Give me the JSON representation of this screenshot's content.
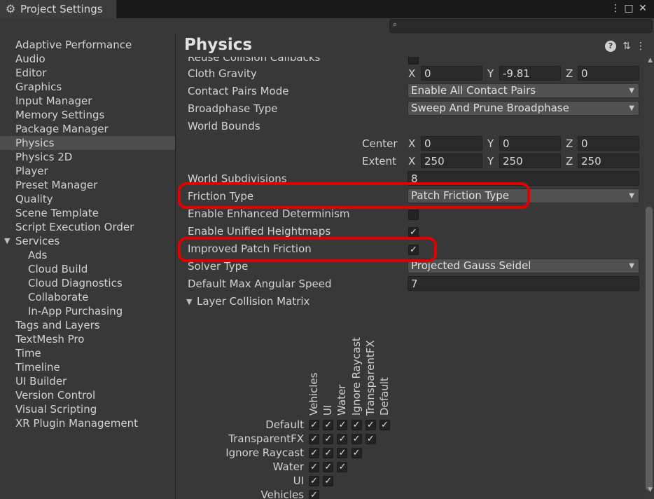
{
  "window": {
    "tab_title": "Project Settings",
    "buttons": {
      "menu": "⋮",
      "maximize": "□",
      "close": "✕"
    }
  },
  "search": {
    "placeholder": "",
    "value": ""
  },
  "sidebar": {
    "items": [
      {
        "label": "Adaptive Performance",
        "indent": 0
      },
      {
        "label": "Audio",
        "indent": 0
      },
      {
        "label": "Editor",
        "indent": 0
      },
      {
        "label": "Graphics",
        "indent": 0
      },
      {
        "label": "Input Manager",
        "indent": 0
      },
      {
        "label": "Memory Settings",
        "indent": 0
      },
      {
        "label": "Package Manager",
        "indent": 0
      },
      {
        "label": "Physics",
        "indent": 0,
        "selected": true
      },
      {
        "label": "Physics 2D",
        "indent": 0
      },
      {
        "label": "Player",
        "indent": 0
      },
      {
        "label": "Preset Manager",
        "indent": 0
      },
      {
        "label": "Quality",
        "indent": 0
      },
      {
        "label": "Scene Template",
        "indent": 0
      },
      {
        "label": "Script Execution Order",
        "indent": 0
      },
      {
        "label": "Services",
        "indent": 0,
        "expanded": true
      },
      {
        "label": "Ads",
        "indent": 1
      },
      {
        "label": "Cloud Build",
        "indent": 1
      },
      {
        "label": "Cloud Diagnostics",
        "indent": 1
      },
      {
        "label": "Collaborate",
        "indent": 1
      },
      {
        "label": "In-App Purchasing",
        "indent": 1
      },
      {
        "label": "Tags and Layers",
        "indent": 0
      },
      {
        "label": "TextMesh Pro",
        "indent": 0
      },
      {
        "label": "Time",
        "indent": 0
      },
      {
        "label": "Timeline",
        "indent": 0
      },
      {
        "label": "UI Builder",
        "indent": 0
      },
      {
        "label": "Version Control",
        "indent": 0
      },
      {
        "label": "Visual Scripting",
        "indent": 0
      },
      {
        "label": "XR Plugin Management",
        "indent": 0
      }
    ]
  },
  "physics": {
    "title": "Physics",
    "reuse_collision_callbacks": "Reuse Collision Callbacks",
    "cloth_gravity": {
      "label": "Cloth Gravity",
      "x": "0",
      "y": "-9.81",
      "z": "0"
    },
    "contact_pairs_mode": {
      "label": "Contact Pairs Mode",
      "value": "Enable All Contact Pairs"
    },
    "broadphase_type": {
      "label": "Broadphase Type",
      "value": "Sweep And Prune Broadphase"
    },
    "world_bounds": {
      "label": "World Bounds",
      "center": {
        "label": "Center",
        "x": "0",
        "y": "0",
        "z": "0"
      },
      "extent": {
        "label": "Extent",
        "x": "250",
        "y": "250",
        "z": "250"
      }
    },
    "world_subdivisions": {
      "label": "World Subdivisions",
      "value": "8"
    },
    "friction_type": {
      "label": "Friction Type",
      "value": "Patch Friction Type"
    },
    "enhanced_determinism": {
      "label": "Enable Enhanced Determinism",
      "checked": false
    },
    "unified_heightmaps": {
      "label": "Enable Unified Heightmaps",
      "checked": true
    },
    "improved_patch_friction": {
      "label": "Improved Patch Friction",
      "checked": true
    },
    "solver_type": {
      "label": "Solver Type",
      "value": "Projected Gauss Seidel"
    },
    "default_max_angular_speed": {
      "label": "Default Max Angular Speed",
      "value": "7"
    },
    "layer_collision_matrix": {
      "label": "Layer Collision Matrix",
      "columns": [
        "Vehicles",
        "UI",
        "Water",
        "Ignore Raycast",
        "TransparentFX",
        "Default"
      ],
      "rows": [
        "Default",
        "TransparentFX",
        "Ignore Raycast",
        "Water",
        "UI",
        "Vehicles"
      ]
    }
  },
  "axis_labels": {
    "x": "X",
    "y": "Y",
    "z": "Z"
  },
  "glyphs": {
    "check": "✓",
    "caret": "▼",
    "help": "?",
    "presets": "⇅",
    "more": "⋮",
    "search": "🔍",
    "gear": "⚙"
  },
  "colors": {
    "highlight": "#e00000",
    "selected_bg": "#4d4d4d",
    "panel_bg": "#383838"
  }
}
